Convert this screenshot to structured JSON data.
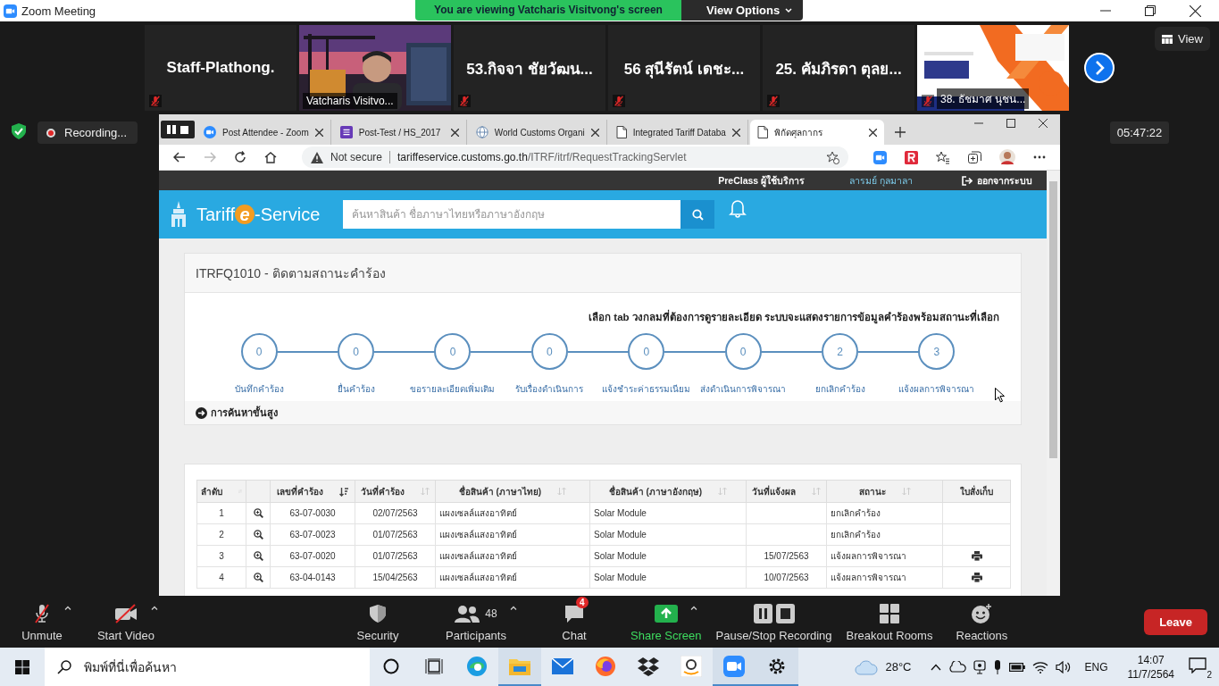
{
  "window": {
    "title": "Zoom Meeting"
  },
  "banner": {
    "text": "You are viewing Vatcharis Visitvong's screen",
    "view_options": "View Options"
  },
  "participants": [
    {
      "kind": "name",
      "name": "Staff-Plathong.",
      "muted": true,
      "speaking": false
    },
    {
      "kind": "video",
      "name": "Vatcharis Visitvo...",
      "muted": false,
      "speaking": true
    },
    {
      "kind": "name",
      "name": "53.กิจจา ชัยวัฒน...",
      "muted": true,
      "speaking": false
    },
    {
      "kind": "name",
      "name": "56 สุนีรัตน์ เดชะ...",
      "muted": true,
      "speaking": false
    },
    {
      "kind": "name",
      "name": "25. คัมภิรดา ตุลย...",
      "muted": true,
      "speaking": false
    },
    {
      "kind": "poster",
      "name": "38. ธัชมาศ นุชน...",
      "muted": true,
      "speaking": false
    }
  ],
  "view_button": "View",
  "recording": "Recording...",
  "timer": "05:47:22",
  "browser": {
    "tabs": [
      {
        "title": "Post Attendee - Zoom",
        "kind": "zoom",
        "selected": false
      },
      {
        "title": "Post-Test / HS_2017",
        "kind": "form",
        "selected": false
      },
      {
        "title": "World Customs Organi",
        "kind": "globe",
        "selected": false
      },
      {
        "title": "Integrated Tariff Databa",
        "kind": "page",
        "selected": false
      },
      {
        "title": "พิกัดศุลกากร",
        "kind": "page",
        "selected": true
      }
    ],
    "security": "Not secure",
    "host": "tariffeservice.customs.go.th",
    "path": "/ITRF/itrf/RequestTrackingServlet"
  },
  "site": {
    "user_type": "PreClass ผู้ใช้บริการ",
    "user_name": "ลารมย์ กุลมาลา",
    "logout": "ออกจากระบบ",
    "logo": {
      "pre": "Tariff",
      "mark": "e",
      "post": "-Service"
    },
    "search_placeholder": "ค้นหาสินค้า ชื่อภาษาไทยหรือภาษาอังกฤษ",
    "panel_title": "ITRFQ1010 - ติดตามสถานะคำร้อง",
    "instruction": "เลือก tab วงกลมที่ต้องการดูรายละเอียด ระบบจะแสดงรายการข้อมูลคำร้องพร้อมสถานะที่เลือก",
    "steps": [
      {
        "count": "0",
        "label": "บันทึกคำร้อง"
      },
      {
        "count": "0",
        "label": "ยื่นคำร้อง"
      },
      {
        "count": "0",
        "label": "ขอรายละเอียดเพิ่มเติม"
      },
      {
        "count": "0",
        "label": "รับเรื่องดำเนินการ"
      },
      {
        "count": "0",
        "label": "แจ้งชำระค่าธรรมเนียม"
      },
      {
        "count": "0",
        "label": "ส่งดำเนินการพิจารณา"
      },
      {
        "count": "2",
        "label": "ยกเลิกคำร้อง"
      },
      {
        "count": "3",
        "label": "แจ้งผลการพิจารณา"
      }
    ],
    "advanced_search": "การค้นหาขั้นสูง",
    "table": {
      "columns": [
        {
          "label": "ลำดับ",
          "sorted": false
        },
        {
          "label": "เลขที่คำร้อง",
          "sorted": true
        },
        {
          "label": "วันที่คำร้อง",
          "sorted": false
        },
        {
          "label": "ชื่อสินค้า (ภาษาไทย)",
          "sorted": false
        },
        {
          "label": "ชื่อสินค้า (ภาษาอังกฤษ)",
          "sorted": false
        },
        {
          "label": "วันที่แจ้งผล",
          "sorted": false
        },
        {
          "label": "สถานะ",
          "sorted": false
        },
        {
          "label": "ใบสั่งเก็บ"
        }
      ],
      "rows": [
        {
          "no": "1",
          "number": "63-07-0030",
          "date": "02/07/2563",
          "name_th": "แผงเซลล์แสงอาทิตย์",
          "name_en": "Solar Module",
          "status": "ยกเลิกคำร้อง",
          "printable": false
        },
        {
          "no": "2",
          "number": "63-07-0023",
          "date": "01/07/2563",
          "name_th": "แผงเซลล์แสงอาทิตย์",
          "name_en": "Solar Module",
          "status": "ยกเลิกคำร้อง",
          "printable": false
        },
        {
          "no": "3",
          "number": "63-07-0020",
          "date": "01/07/2563",
          "name_th": "แผงเซลล์แสงอาทิตย์",
          "name_en": "Solar Module",
          "notify_date": "15/07/2563",
          "status": "แจ้งผลการพิจารณา",
          "printable": true
        },
        {
          "no": "4",
          "number": "63-04-0143",
          "date": "15/04/2563",
          "name_th": "แผงเซลล์แสงอาทิตย์",
          "name_en": "Solar Module",
          "notify_date": "10/07/2563",
          "status": "แจ้งผลการพิจารณา",
          "printable": true
        }
      ]
    }
  },
  "toolbar": [
    {
      "kind": "mic",
      "label": "Unmute",
      "caret": true
    },
    {
      "kind": "video",
      "label": "Start Video",
      "caret": true
    },
    {
      "kind": "security",
      "label": "Security",
      "caret": false
    },
    {
      "kind": "participants",
      "label": "Participants",
      "count": "48",
      "caret": true
    },
    {
      "kind": "chat",
      "label": "Chat",
      "badge": "4",
      "caret": false
    },
    {
      "kind": "share",
      "label": "Share Screen",
      "caret": true
    },
    {
      "kind": "record",
      "label": "Pause/Stop Recording",
      "caret": false
    },
    {
      "kind": "breakout",
      "label": "Breakout Rooms",
      "caret": false
    },
    {
      "kind": "reactions",
      "label": "Reactions",
      "caret": false
    }
  ],
  "leave": "Leave",
  "taskbar": {
    "search_placeholder": "พิมพ์ที่นี่เพื่อค้นหา",
    "apps": [
      {
        "kind": "cortana",
        "active": false
      },
      {
        "kind": "taskview",
        "active": false
      },
      {
        "kind": "edge",
        "active": false
      },
      {
        "kind": "explorer",
        "active": true
      },
      {
        "kind": "mail",
        "active": false
      },
      {
        "kind": "firefox",
        "active": false
      },
      {
        "kind": "dropbox",
        "active": false
      },
      {
        "kind": "amazon",
        "active": false
      },
      {
        "kind": "zoom",
        "active": true
      },
      {
        "kind": "settings",
        "active": true
      }
    ],
    "temperature": "28°C",
    "language": "ENG",
    "time": "14:07",
    "date": "11/7/2564",
    "notifications": "2"
  }
}
